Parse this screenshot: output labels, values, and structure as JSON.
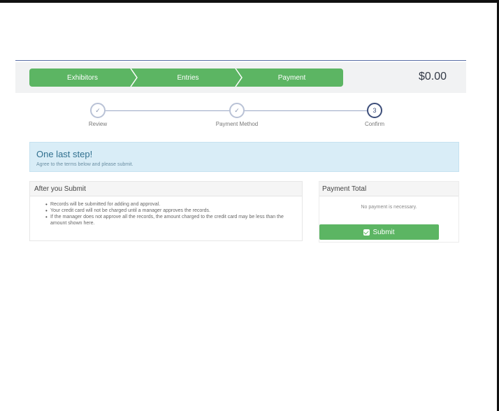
{
  "header": {
    "steps": [
      "Exhibitors",
      "Entries",
      "Payment"
    ],
    "total": "$0.00"
  },
  "progress": {
    "steps": [
      {
        "label": "Review",
        "state": "done",
        "glyph": "✓"
      },
      {
        "label": "Payment Method",
        "state": "done",
        "glyph": "✓"
      },
      {
        "label": "Confirm",
        "state": "current",
        "glyph": "3"
      }
    ]
  },
  "alert": {
    "title": "One last step!",
    "text": "Agree to the terms below and please submit."
  },
  "after_submit": {
    "title": "After you Submit",
    "items": [
      "Records will be submitted for adding and approval.",
      "Your credit card will not be charged until a manager approves the records.",
      "If the manager does not approve all the records, the amount charged to the credit card may be less than the amount shown here."
    ]
  },
  "payment_total": {
    "title": "Payment Total",
    "note": "No payment is necessary.",
    "submit_label": "Submit"
  },
  "colors": {
    "accent_green": "#5cb563",
    "info_bg": "#d9edf7",
    "step_current": "#3c4d79"
  }
}
